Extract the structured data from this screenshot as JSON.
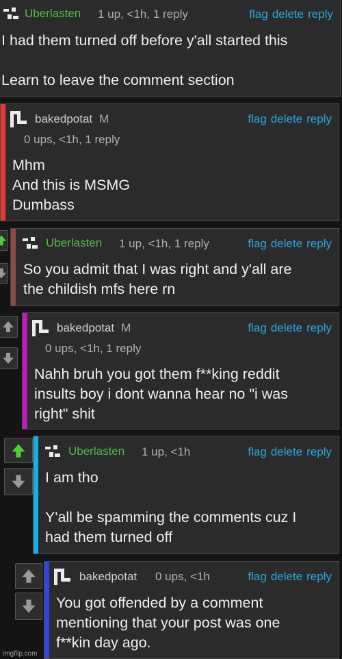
{
  "actions": {
    "flag": "flag",
    "delete": "delete",
    "reply": "reply"
  },
  "comments": [
    {
      "user": "Uberlasten",
      "meta": "1 up, <1h, 1 reply",
      "body": "I had them turned off before y'all started this\n\nLearn to leave the comment section"
    },
    {
      "user": "bakedpotat",
      "badge": "M",
      "meta": "0 ups, <1h, 1 reply",
      "body": "Mhm\nAnd this is MSMG\nDumbass"
    },
    {
      "user": "Uberlasten",
      "meta": "1 up, <1h, 1 reply",
      "body": "So you admit that I was right and y'all are\nthe childish mfs here rn"
    },
    {
      "user": "bakedpotat",
      "badge": "M",
      "meta": "0 ups, <1h, 1 reply",
      "body": "Nahh bruh you got them f**king reddit\ninsults boy i dont wanna hear no \"i was\nright\" shit"
    },
    {
      "user": "Uberlasten",
      "meta": "1 up, <1h",
      "body": "I am tho\n\nY'all be spamming the comments cuz I\nhad them turned off"
    },
    {
      "user": "bakedpotat",
      "meta": "0 ups, <1h",
      "body": "You got offended by a comment\nmentioning that your post was one\nf**kin day ago."
    }
  ],
  "colors": {
    "level2": "#e53935",
    "level3": "#8a4a48",
    "level4": "#c21bbd",
    "level5": "#17aee3",
    "level6": "#3445e8",
    "upvoted": "#4cd137"
  },
  "watermark": "imgflip.com"
}
